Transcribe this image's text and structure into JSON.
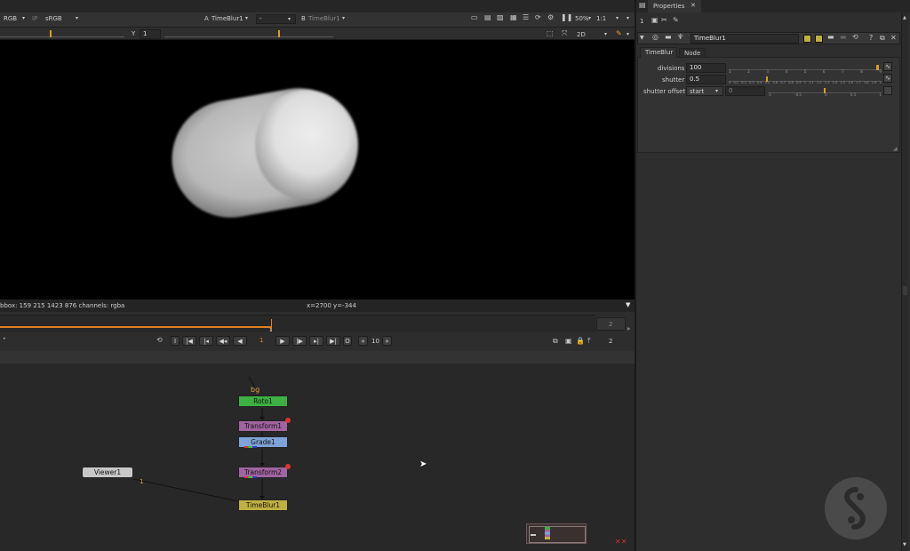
{
  "viewer_toolbar": {
    "channel": "RGB",
    "ip_label": "IP",
    "colorspace": "sRGB",
    "a_label": "A",
    "a_input": "TimeBlur1",
    "composite": "-",
    "b_label": "B",
    "b_input": "TimeBlur1",
    "zoom": "50%",
    "ratio": "1:1",
    "y_label": "Y",
    "y_value": "1",
    "view_mode": "2D"
  },
  "viewer_status": {
    "bbox": "bbox: 159 215 1423 876 channels: rgba",
    "coords": "x=2700 y=-344"
  },
  "timeline": {
    "current_frame_marker": "1",
    "end_frame": "2",
    "frame_field": "1",
    "increment": "10",
    "out_frame": "2"
  },
  "properties": {
    "tab_title": "Properties",
    "tab_number": "1",
    "node_name": "TimeBlur1",
    "tabs": [
      "TimeBlur",
      "Node"
    ],
    "params": {
      "divisions_label": "divisions",
      "divisions_value": "100",
      "shutter_label": "shutter",
      "shutter_value": "0.5",
      "shutter_offset_label": "shutter offset",
      "shutter_offset_mode": "start",
      "shutter_offset_value": "0"
    },
    "slider_ticks_divisions": [
      "1",
      "2",
      "3",
      "4",
      "5",
      "6",
      "7",
      "8",
      "9"
    ],
    "slider_ticks_shutter": [
      "0",
      "0.1",
      "0.2",
      "0.3",
      "0.4",
      "0.5",
      "0.6",
      "0.7",
      "0.8",
      "0.9",
      "1",
      "1.1",
      "1.2",
      "1.3",
      "1.4",
      "1.5",
      "1.6",
      "1.7",
      "1.8",
      "1.9",
      "2"
    ],
    "slider_ticks_offset": [
      "-1",
      "-0.5",
      "0",
      "0.5",
      "1"
    ]
  },
  "nodegraph": {
    "bg_label": "bg",
    "nodes": {
      "roto": "Roto1",
      "transform1": "Transform1",
      "grade": "Grade1",
      "transform2": "Transform2",
      "timeblur": "TimeBlur1",
      "viewer": "Viewer1"
    },
    "viewer_input_label": "1"
  },
  "colors": {
    "roto": "#3cb043",
    "transform": "#a064a0",
    "grade": "#7ea3d8",
    "timeblur": "#c0b040",
    "viewer": "#c8c8c8",
    "accent": "#e08020"
  }
}
